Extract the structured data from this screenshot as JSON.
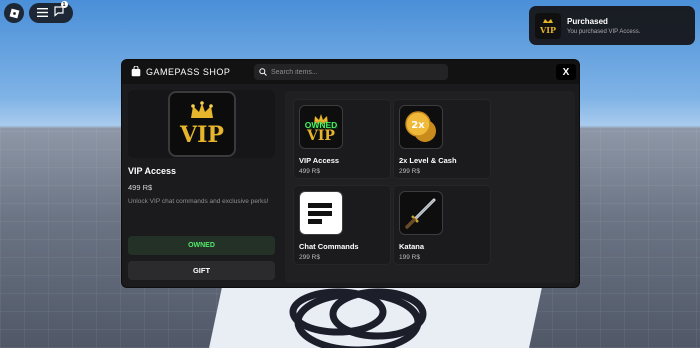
{
  "topbar": {
    "logo_icon": "roblox-logo-icon",
    "menu_icon": "hamburger-menu-icon",
    "chat_icon": "chat-icon",
    "chat_badge": "1"
  },
  "toast": {
    "title": "Purchased",
    "message": "You purchased VIP Access.",
    "thumb_text": "VIP"
  },
  "shop": {
    "title": "GAMEPASS SHOP",
    "search_placeholder": "Search items...",
    "close_label": "X",
    "selected": {
      "image_text": "VIP",
      "name": "VIP Access",
      "price": "499 R$",
      "description": "Unlock VIP chat commands and exclusive perks!",
      "owned_label": "OWNED",
      "gift_label": "GIFT"
    },
    "items": [
      {
        "name": "VIP Access",
        "price": "499 R$",
        "icon": "vip-crown-icon",
        "owned": "OWNED",
        "icon_text": "VIP"
      },
      {
        "name": "2x Level & Cash",
        "price": "299 R$",
        "icon": "coins-2x-icon",
        "icon_text": "2x"
      },
      {
        "name": "Chat Commands",
        "price": "299 R$",
        "icon": "chat-commands-icon"
      },
      {
        "name": "Katana",
        "price": "199 R$",
        "icon": "katana-icon"
      }
    ]
  },
  "colors": {
    "accent_owned": "#54e86b",
    "gold": "#e7b52c",
    "panel": "#1b1b1d"
  }
}
